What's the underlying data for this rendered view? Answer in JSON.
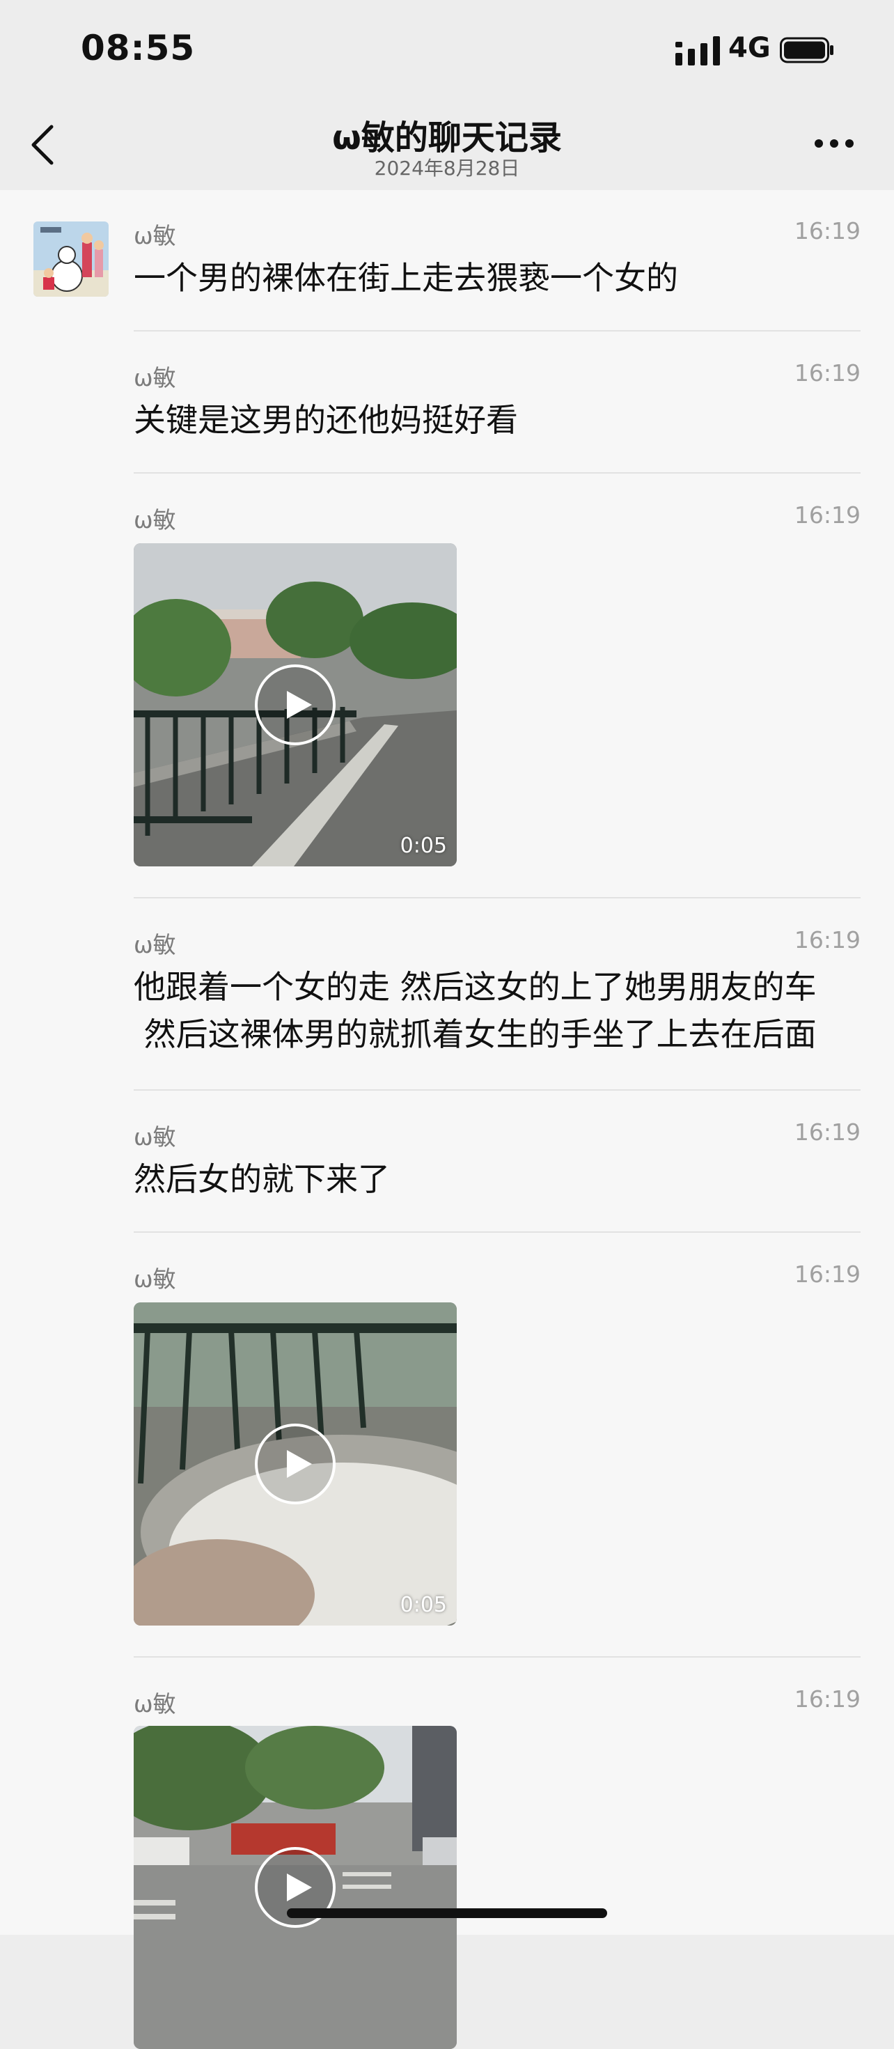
{
  "status_bar": {
    "time": "08:55",
    "network": "4G",
    "icons": [
      "signal-icon",
      "battery-icon"
    ]
  },
  "header": {
    "title": "ω敏的聊天记录",
    "date": "2024年8月28日",
    "icons": [
      "back-icon",
      "more-icon"
    ]
  },
  "messages": [
    {
      "sender": "ω敏",
      "time": "16:19",
      "type": "text",
      "text": "一个男的裸体在街上走去猥亵一个女的"
    },
    {
      "sender": "ω敏",
      "time": "16:19",
      "type": "text",
      "text": "关键是这男的还他妈挺好看"
    },
    {
      "sender": "ω敏",
      "time": "16:19",
      "type": "video",
      "duration": "0:05"
    },
    {
      "sender": "ω敏",
      "time": "16:19",
      "type": "text",
      "lines": [
        "他跟着一个女的走 然后这女的上了她男朋友的车",
        " 然后这裸体男的就抓着女生的手坐了上去在后面"
      ]
    },
    {
      "sender": "ω敏",
      "time": "16:19",
      "type": "text",
      "text": "然后女的就下来了"
    },
    {
      "sender": "ω敏",
      "time": "16:19",
      "type": "video",
      "duration": "0:05"
    },
    {
      "sender": "ω敏",
      "time": "16:19",
      "type": "video",
      "duration": ""
    }
  ]
}
